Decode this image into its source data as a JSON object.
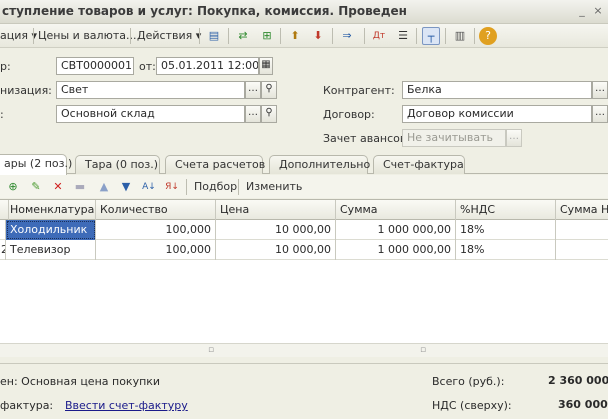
{
  "window": {
    "title": "ступление товаров и услуг: Покупка, комиссия. Проведен",
    "minimize": "_",
    "close": "×"
  },
  "toolbar": {
    "operation_label": "ация ▾",
    "prices_label": "Цены и валюта...",
    "actions_label": "Действия ▾"
  },
  "form": {
    "number_label": "р:",
    "number_value": "СВТ00000011",
    "date_label": "от:",
    "date_value": "05.01.2011 12:00:00",
    "org_label": "низация:",
    "org_value": "Свет",
    "warehouse_label": ":",
    "warehouse_value": "Основной склад",
    "contractor_label": "Контрагент:",
    "contractor_value": "Белка",
    "contract_label": "Договор:",
    "contract_value": "Договор комиссии",
    "advance_label": "Зачет авансов:",
    "advance_value": "Не зачитывать"
  },
  "tabs": [
    {
      "label": "ары (2 поз.)"
    },
    {
      "label": "Тара (0 поз.)"
    },
    {
      "label": "Счета расчетов"
    },
    {
      "label": "Дополнительно"
    },
    {
      "label": "Счет-фактура"
    }
  ],
  "table_toolbar": {
    "selection_label": "Подбор",
    "edit_label": "Изменить"
  },
  "table": {
    "columns": [
      "Номенклатура",
      "Количество",
      "Цена",
      "Сумма",
      "%НДС",
      "Сумма НДС"
    ],
    "rows": [
      {
        "n": "",
        "name": "Холодильник",
        "qty": "100,000",
        "price": "10 000,00",
        "sum": "1 000 000,00",
        "vat_rate": "18%"
      },
      {
        "n": "2",
        "name": "Телевизор",
        "qty": "100,000",
        "price": "10 000,00",
        "sum": "1 000 000,00",
        "vat_rate": "18%"
      }
    ]
  },
  "footer": {
    "price_type": "ен: Основная цена покупки",
    "invoice_label": "фактура:",
    "invoice_link": "Ввести счет-фактуру",
    "total_label": "Всего (руб.):",
    "total_value": "2 360 000,",
    "vat_label": "НДС (сверху):",
    "vat_value": "360 000,"
  }
}
